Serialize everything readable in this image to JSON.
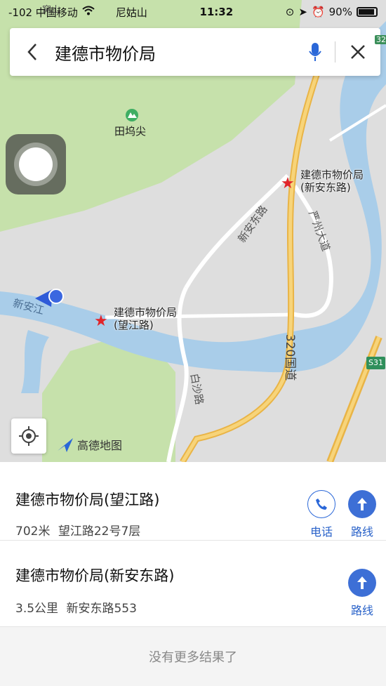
{
  "status_bar": {
    "carrier": "-102 中国移动",
    "location_hint": "尼姑山",
    "time": "11:32",
    "battery": "90%"
  },
  "search": {
    "query": "建德市物价局",
    "icons": {
      "back": "chevron-left-icon",
      "mic": "microphone-icon",
      "close": "close-icon"
    },
    "accent": "#2a67d8"
  },
  "map": {
    "labels": {
      "peak": "田坞尖",
      "top_left_partial": "窝山",
      "road_xinan": "新安东路",
      "road_yanzhou": "严州大道",
      "river": "新安江",
      "road_baisha": "白沙路",
      "highway": "320国道",
      "highway_badge": "S31",
      "top_badge": "32"
    },
    "pois": [
      {
        "name": "建德市物价局",
        "sub": "(新安东路)"
      },
      {
        "name": "建德市物价局",
        "sub": "(望江路)"
      }
    ],
    "brand": "高德地图",
    "colors": {
      "green": "#c4e0a9",
      "water": "#a9cde9",
      "road": "#ffffff",
      "highway": "#f4c95d"
    }
  },
  "results": [
    {
      "title": "建德市物价局(望江路)",
      "distance": "702米",
      "address": "望江路22号7层",
      "actions": [
        "电话",
        "路线"
      ]
    },
    {
      "title": "建德市物价局(新安东路)",
      "distance": "3.5公里",
      "address": "新安东路553",
      "actions": [
        "路线"
      ]
    }
  ],
  "footer": "没有更多结果了"
}
